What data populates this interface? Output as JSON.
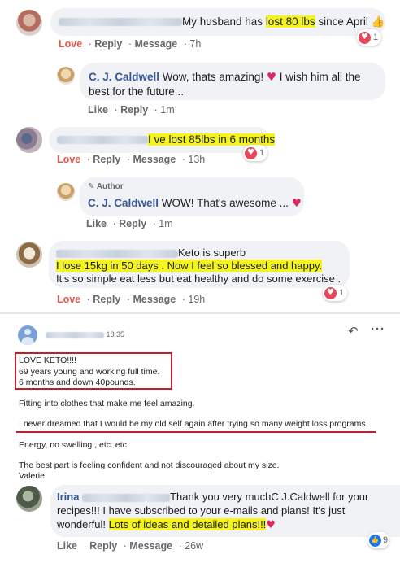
{
  "comments": [
    {
      "text_prefix": "My husband has ",
      "text_highlight": "lost 80 lbs",
      "text_suffix": " since April",
      "emoji": "👍",
      "actions": [
        "Love",
        "Reply",
        "Message"
      ],
      "time": "7h",
      "reaction_count": "1"
    },
    {
      "author": "C. J. Caldwell",
      "text": "Wow, thats amazing!",
      "text_suffix": " I wish him all the",
      "text_line2": "best for the future...",
      "actions": [
        "Like",
        "Reply"
      ],
      "time": "1m"
    },
    {
      "text_highlight": "I ve lost 85lbs in 6 months",
      "actions": [
        "Love",
        "Reply",
        "Message"
      ],
      "time": "13h",
      "reaction_count": "1"
    },
    {
      "badge": "Author",
      "author": "C. J. Caldwell",
      "text": "WOW! That's awesome ...",
      "actions": [
        "Like",
        "Reply"
      ],
      "time": "1m"
    },
    {
      "text_line1": "Keto is superb",
      "text_highlight": "I lose 15kg in 50 days . Now I feel so blessed and happy.",
      "text_line3": "It's so simple eat less but eat healthy and do some exercise .",
      "actions": [
        "Love",
        "Reply",
        "Message"
      ],
      "time": "19h",
      "reaction_count": "1"
    }
  ],
  "message_panel": {
    "time": "18:35",
    "box_lines": [
      "LOVE KETO!!!!",
      "69 years young and working full time.",
      "6 months and down 40pounds."
    ],
    "line_fitting": "Fitting into clothes that make me feel amazing.",
    "line_never": "I never dreamed that I would be my old self again after trying so many weight loss programs.",
    "line_energy": "Energy, no swelling , etc. etc.",
    "line_best": "The best part is feeling confident and not discouraged about my size.",
    "signature": "Valerie",
    "reply_icon": "reply-arrow-icon",
    "more_icon": "more-dots-icon"
  },
  "last_comment": {
    "author": "Irina",
    "line1": "Thank you very muchC.J.Caldwell for your",
    "line2": "recipes!!! I have subscribed to your e-mails and plans! It's just",
    "line3_prefix": "wonderful! ",
    "line3_highlight": "Lots of ideas and detailed plans!!!",
    "actions": [
      "Like",
      "Reply",
      "Message"
    ],
    "time": "26w",
    "reaction_count": "9"
  },
  "colors": {
    "highlight": "#f6f41d",
    "love": "#e4584f",
    "link": "#385898",
    "bubble": "#f0f2f5",
    "red_box": "#c0202a"
  }
}
